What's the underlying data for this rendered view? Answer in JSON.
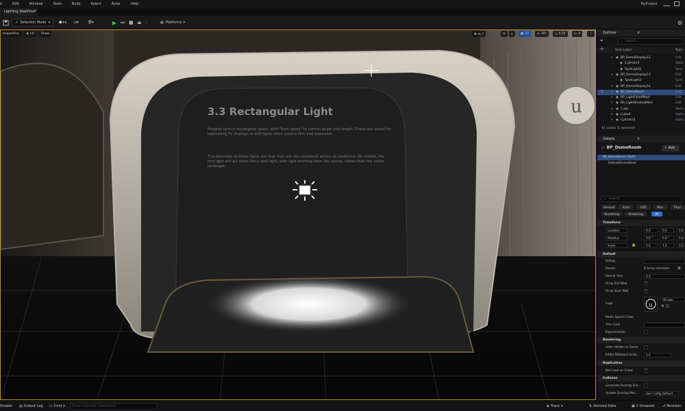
{
  "menu": [
    "e",
    "Edit",
    "Window",
    "Tools",
    "Build",
    "Select",
    "Actor",
    "Help"
  ],
  "project_name": "MyProject",
  "doc_tab": "Lighting_Realtime*",
  "toolbar": {
    "selection_mode": "Selection Mode",
    "platforms": "Platforms"
  },
  "viewport": {
    "perspective": "erspective",
    "lit": "Lit",
    "show": "Show",
    "grid_value": "10",
    "angle_value": "10°",
    "scale_value": "0.25",
    "camera_speed": "4",
    "sign_title": "3.3 Rectangular Light",
    "sign_para1": "Projects from a rectangular plane, with \"barn doors\" to control angle and length. These are useful for replicating TV displays or soft lights often used in film and television.",
    "sign_para2": "The downside to these lights are that they are not consistent across all platforms. On mobile, the rect light will act more like a spot light, with light emitting from the center, rather than the entire rectangle."
  },
  "outliner": {
    "title": "Outliner",
    "search_placeholder": "Search...",
    "col_label": "Item Label",
    "col_type": "Type",
    "rows": [
      {
        "label": "BP_DemoDisplay12",
        "type": "Edit",
        "indent": 0,
        "selected": false
      },
      {
        "label": "Cylinder5",
        "type": "Static",
        "indent": 1,
        "selected": false
      },
      {
        "label": "SpotLight2",
        "type": "Spot",
        "indent": 1,
        "selected": false
      },
      {
        "label": "BP_DemoDisplay13",
        "type": "Edit",
        "indent": 0,
        "selected": false
      },
      {
        "label": "SpotLight3",
        "type": "Spot",
        "indent": 1,
        "selected": false
      },
      {
        "label": "BP_DemoDisplay14",
        "type": "Edit",
        "indent": 0,
        "selected": false
      },
      {
        "label": "BP_DemoRoom",
        "type": "Edit",
        "indent": 0,
        "selected": true
      },
      {
        "label": "BP_LightFalloffMod",
        "type": "Edit",
        "indent": 0,
        "selected": false
      },
      {
        "label": "BP_LightShadowMod",
        "type": "Edit",
        "indent": 0,
        "selected": false
      },
      {
        "label": "Cube",
        "type": "Static",
        "indent": 0,
        "selected": false
      },
      {
        "label": "Cube6",
        "type": "Static",
        "indent": 0,
        "selected": false
      },
      {
        "label": "Cylinder3",
        "type": "Static",
        "indent": 0,
        "selected": false
      }
    ],
    "footer": "41 actors (1 selected)"
  },
  "details": {
    "title": "Details",
    "object": "BP_DemoRoom",
    "add": "Add",
    "comp_root": "BP_DemoRoom (Self)",
    "comp_child": "DefaultSceneRoot",
    "search_placeholder": "Search",
    "filters_row1": [
      "General",
      "Actor",
      "LOD",
      "Misc",
      "Phys"
    ],
    "filters_row2": [
      "Rendering",
      "Streaming",
      "All"
    ],
    "transform": {
      "header": "Transform",
      "location": "Location",
      "rotation": "Rotation",
      "scale": "Scale",
      "loc": [
        "0.0",
        "0.0",
        "0.0"
      ],
      "rot": [
        "0.0 °",
        "0.0 °",
        "0.0"
      ],
      "scl": [
        "1.0",
        "1.0",
        "1.0"
      ]
    },
    "default": {
      "header": "Default",
      "debug": "Debug",
      "rooms": "Rooms",
      "rooms_val": "6 Array elements",
      "spacer_size": "Spacer Size",
      "spacer_val": "0.1",
      "draw_end": "Draw End Wall",
      "draw_start": "Draw Start Wall",
      "logo": "Logo",
      "logo_val": "UELogo",
      "room_spacer_color": "Room Spacer Color",
      "trim_color": "Trim Color",
      "experimental": "Experimental"
    },
    "rendering": {
      "header": "Rendering",
      "hidden": "Actor Hidden In Game",
      "billboard": "Editor Billboard Scale",
      "billboard_val": "1.0"
    },
    "replication": {
      "header": "Replication",
      "net_load": "Net Load on Client"
    },
    "collision": {
      "header": "Collision",
      "gen_overlap": "Generate Overlap Eve...",
      "update_overlap": "Update Overlap Met...",
      "update_val": "Use Config Default"
    }
  },
  "statusbar": {
    "drawer": "Drawer",
    "output": "Output Log",
    "cmd": "Cmd",
    "cmd_placeholder": "Enter Console Command",
    "trace": "Trace",
    "derived": "Derived Data",
    "unsaved": "1 Unsaved",
    "revision": "Revision"
  },
  "colors": {
    "accent": "#2f6fd8",
    "viewport_border": "#c8901f"
  }
}
